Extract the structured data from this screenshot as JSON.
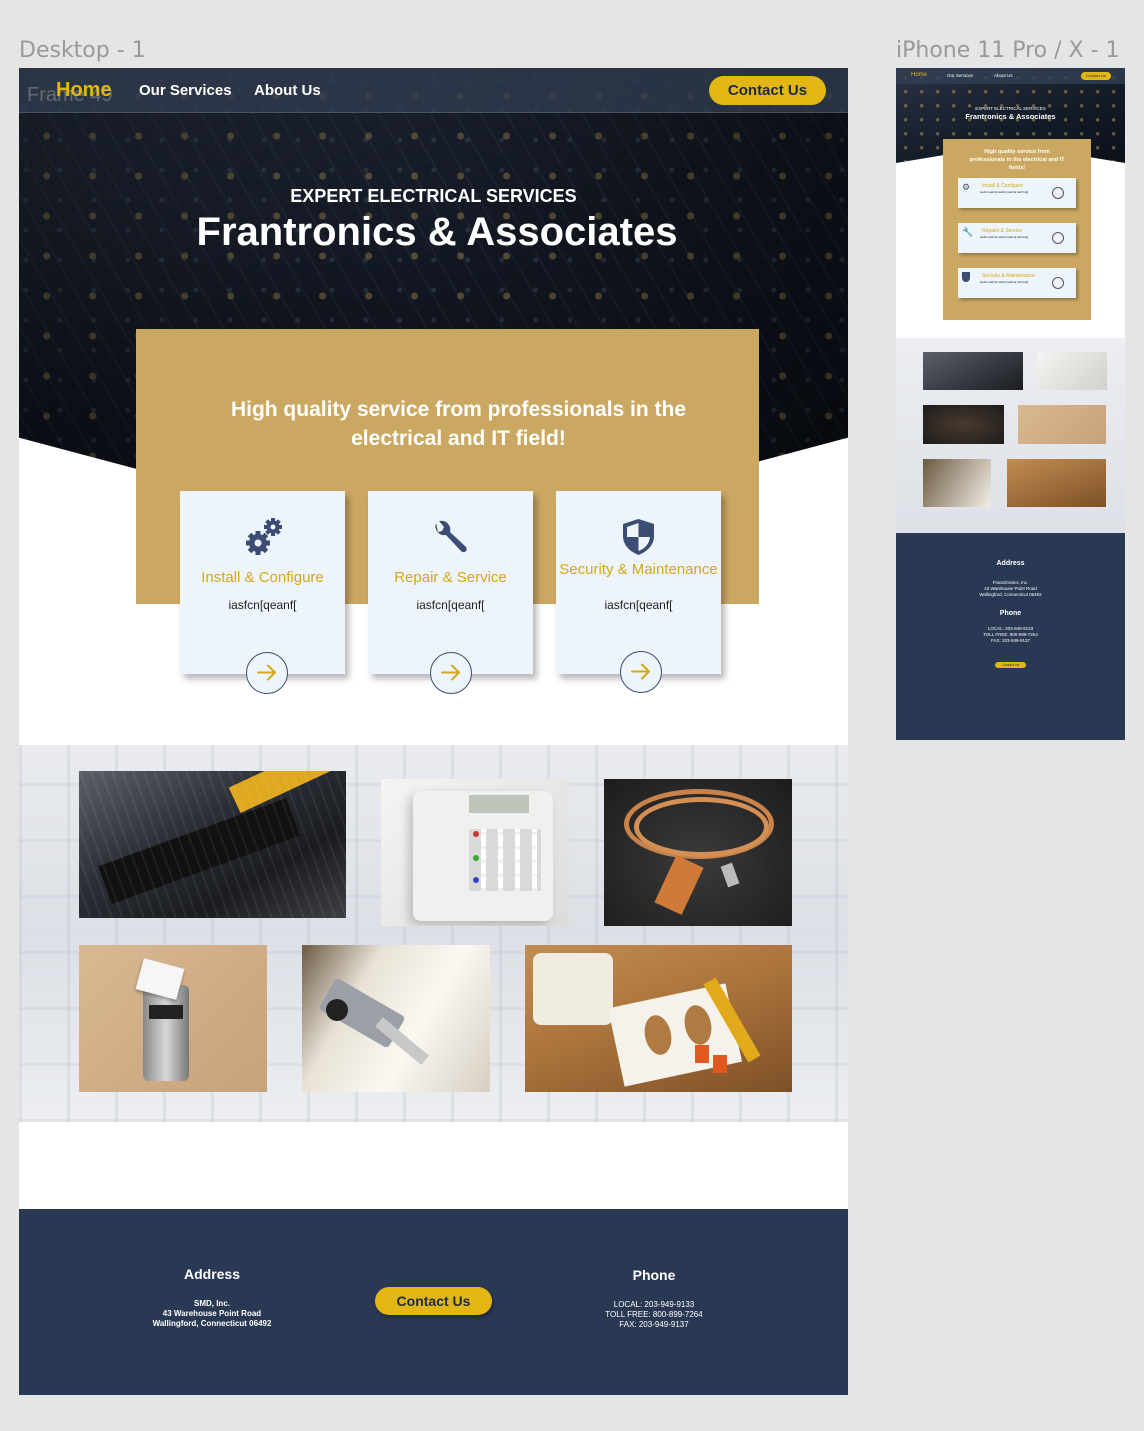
{
  "frames": {
    "desktop_label": "Desktop - 1",
    "mobile_label": "iPhone 11 Pro / X - 1",
    "overlay_label": "Frame 49"
  },
  "nav": {
    "home": "Home",
    "services": "Our Services",
    "about": "About Us",
    "contact": "Contact Us"
  },
  "hero": {
    "subtitle": "EXPERT ELECTRICAL SERVICES",
    "title": "Frantronics & Associates"
  },
  "banner": {
    "text": "High quality service from professionals in the electrical and IT field!"
  },
  "cards": [
    {
      "title": "Install & Configure",
      "desc": "iasfcn[qeanf[",
      "icon": "gears-icon"
    },
    {
      "title": "Repair & Service",
      "desc": "iasfcn[qeanf[",
      "icon": "wrench-icon"
    },
    {
      "title": "Security & Maintenance",
      "desc": "iasfcn[qeanf[",
      "icon": "shield-icon"
    }
  ],
  "gallery": {
    "photos": [
      "motherboard-photo",
      "alarm-keypad-photo",
      "cable-photo",
      "keycard-lock-photo",
      "security-camera-photo",
      "outlet-wiring-photo"
    ]
  },
  "footer": {
    "address_heading": "Address",
    "address_lines": [
      "SMD, Inc.",
      "43 Warehouse Point Road",
      "Wallingford, Connecticut 06492"
    ],
    "contact_button": "Contact Us",
    "phone_heading": "Phone",
    "phone_lines": [
      "LOCAL: 203-949-9133",
      "TOLL FREE: 800-899-7264",
      "FAX: 203-949-9137"
    ]
  },
  "mobile": {
    "nav": {
      "home": "Home",
      "services": "Our Services",
      "about": "About Us",
      "contact": "Contact Us"
    },
    "subtitle": "EXPERT ELECTRICAL SERVICES",
    "title": "Frantronics & Associates",
    "banner": "High quality service from professionals in the electrical and IT fields!",
    "cards": [
      {
        "title": "Install & Configure",
        "desc": "iasfcn iasfcn[ iasfcn[ iasfcn[ iasf bsij[",
        "icon": "gears-icon"
      },
      {
        "title": "Repairs & Service",
        "desc": "iasfcn iasfcn[ iasfcn[ iasfcn[ iasf bsij[",
        "icon": "wrench-icon"
      },
      {
        "title": "Security & Maintenance",
        "desc": "iasfcn iasfcn[ iasfcn[ iasfcn[ iasf bsij[",
        "icon": "shield-icon"
      }
    ],
    "footer": {
      "address_heading": "Address",
      "address_lines": [
        "Francitronics, Inc.",
        "43 Warehouse Point Road",
        "Wallingford, Connecticut 06492"
      ],
      "phone_heading": "Phone",
      "phone_lines": [
        "LOCAL: 203-949-9133",
        "TOLL FREE: 800-899-7264",
        "FAX: 203-949-9137"
      ],
      "contact_button": "Contact Us"
    }
  },
  "colors": {
    "accent": "#e2b714",
    "gold_box": "#cba862",
    "navy": "#293853",
    "card_bg": "#eef4fb",
    "icon": "#3c4d73"
  }
}
